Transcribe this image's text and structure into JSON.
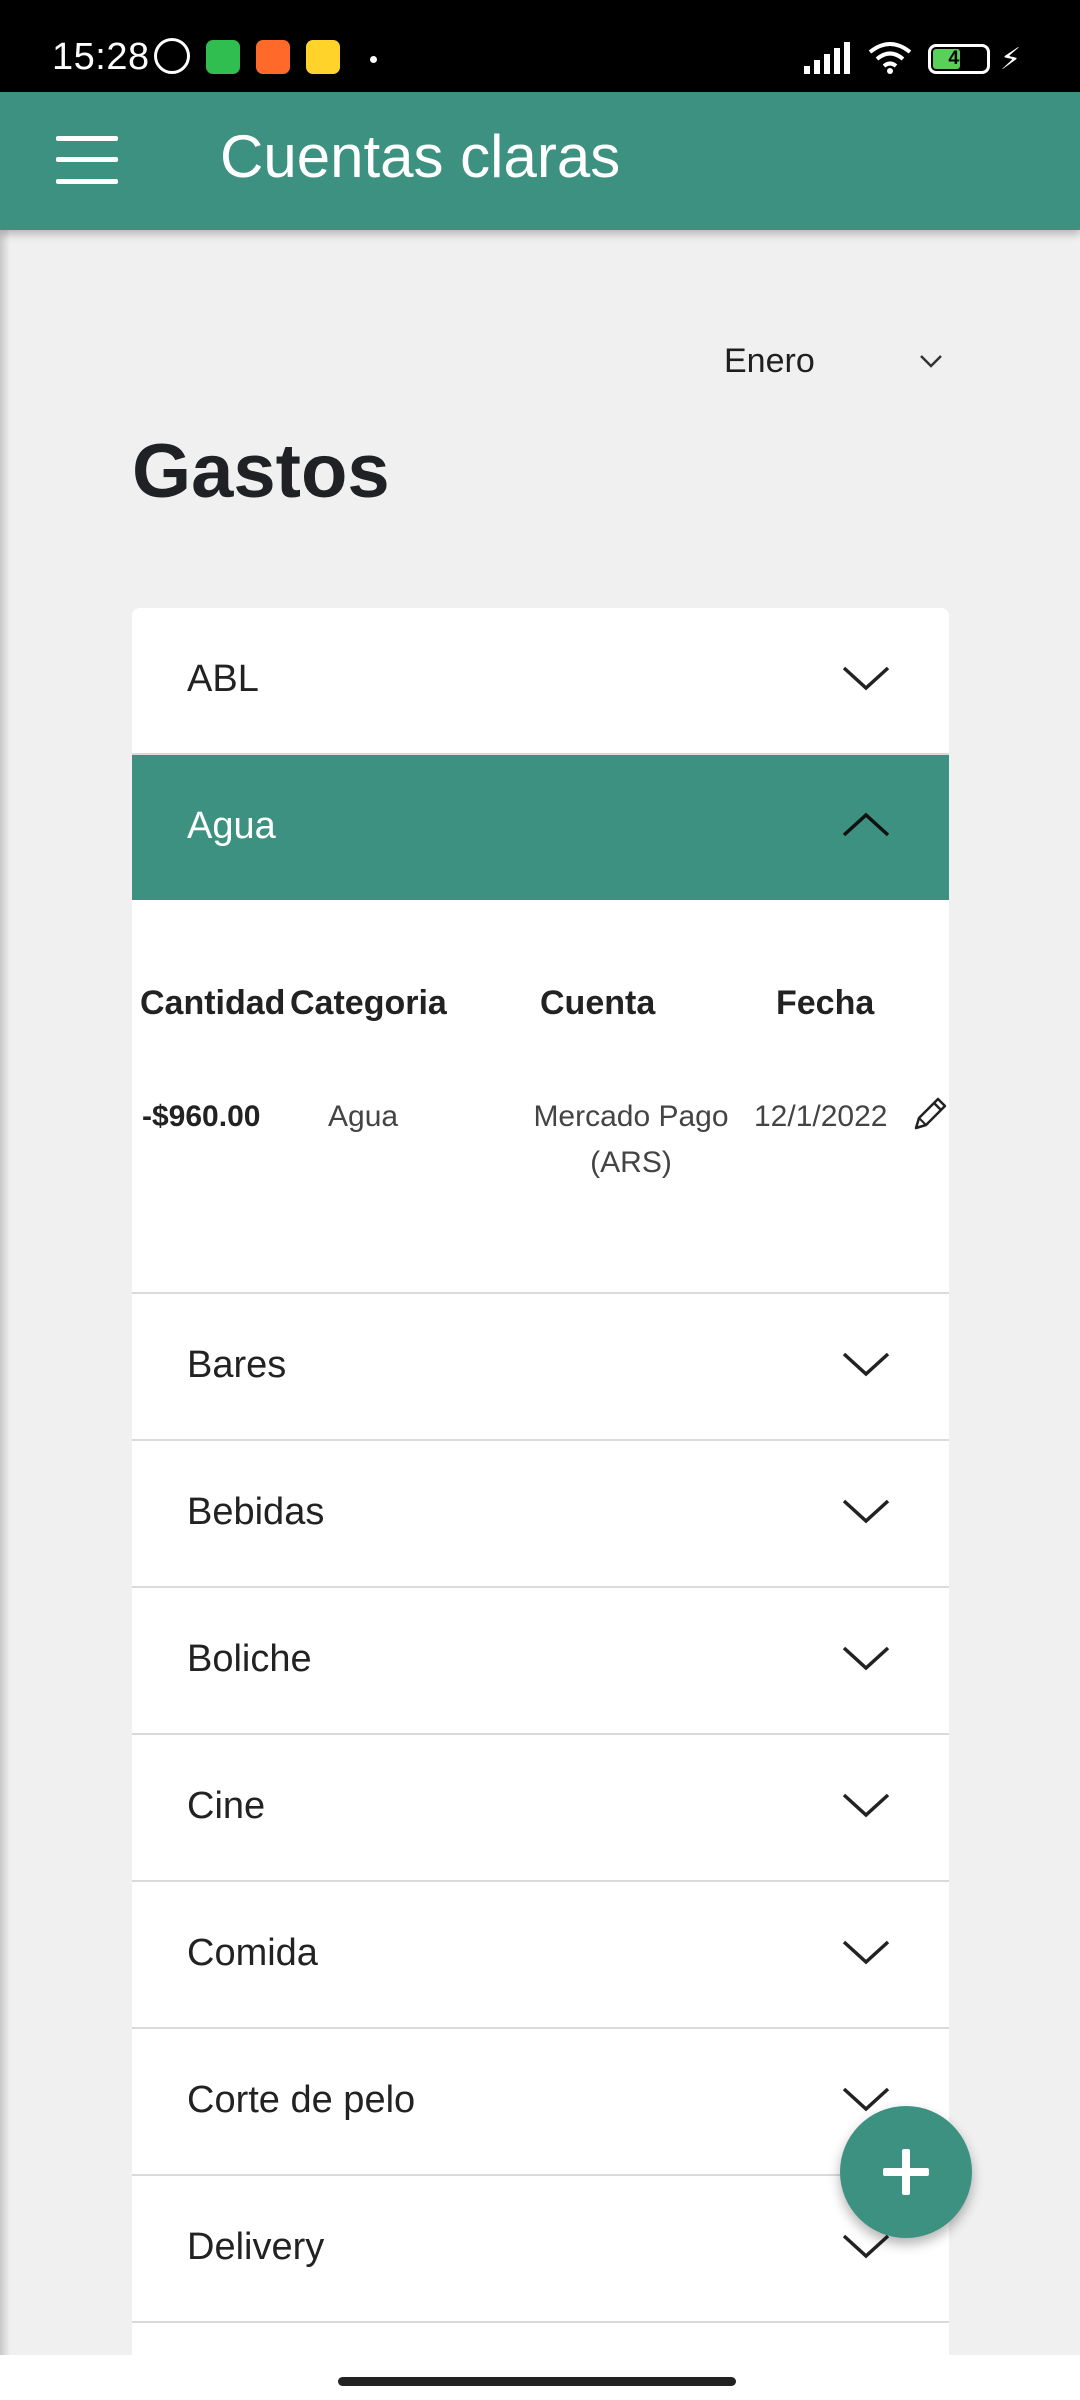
{
  "status_bar": {
    "time": "15:28",
    "battery": "48",
    "icons": [
      "alarm-icon",
      "whatsapp-icon",
      "video-app-icon",
      "smiley-app-icon",
      "notification-dot",
      "signal-icon",
      "wifi-icon",
      "battery-icon",
      "charging-icon"
    ]
  },
  "app_bar": {
    "title": "Cuentas claras",
    "menu_icon": "hamburger-menu-icon"
  },
  "filter": {
    "month": "Enero"
  },
  "page": {
    "title": "Gastos"
  },
  "categories": [
    {
      "label": "ABL",
      "expanded": false
    },
    {
      "label": "Agua",
      "expanded": true
    },
    {
      "label": "Bares",
      "expanded": false
    },
    {
      "label": "Bebidas",
      "expanded": false
    },
    {
      "label": "Boliche",
      "expanded": false
    },
    {
      "label": "Cine",
      "expanded": false
    },
    {
      "label": "Comida",
      "expanded": false
    },
    {
      "label": "Corte de pelo",
      "expanded": false
    },
    {
      "label": "Delivery",
      "expanded": false
    }
  ],
  "expense_table": {
    "headers": [
      "Cantidad",
      "Categoria",
      "Cuenta",
      "Fecha"
    ],
    "rows": [
      {
        "cantidad": "-$960.00",
        "categoria": "Agua",
        "cuenta_line1": "Mercado Pago",
        "cuenta_line2": "(ARS)",
        "fecha": "12/1/2022"
      }
    ]
  },
  "fab": {
    "icon": "plus-icon"
  },
  "colors": {
    "primary": "#3d9180",
    "background": "#f0f0f0"
  }
}
